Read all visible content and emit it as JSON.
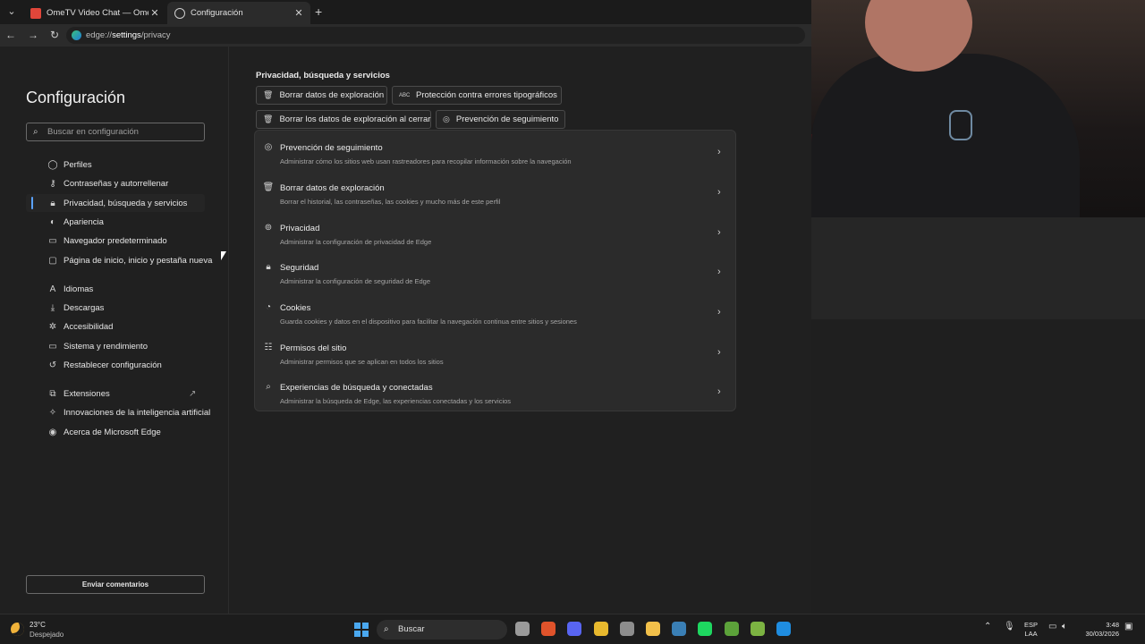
{
  "browser": {
    "tabs": [
      {
        "title": "OmeTV Video Chat — Omegle Ra",
        "active": false
      },
      {
        "title": "Configuración",
        "active": true
      }
    ],
    "address": {
      "scheme": "edge://",
      "host": "settings",
      "path": "/privacy"
    }
  },
  "sidebar": {
    "title": "Configuración",
    "search_placeholder": "Buscar en configuración",
    "items": [
      {
        "label": "Perfiles",
        "icon": "profile-icon"
      },
      {
        "label": "Contraseñas y autorrellenar",
        "icon": "key-icon"
      },
      {
        "label": "Privacidad, búsqueda y servicios",
        "icon": "lock-icon",
        "active": true
      },
      {
        "label": "Apariencia",
        "icon": "palette-icon"
      },
      {
        "label": "Navegador predeterminado",
        "icon": "browser-icon"
      },
      {
        "label": "Página de inicio, inicio y pestaña nueva",
        "icon": "home-icon"
      },
      {
        "label": "Idiomas",
        "icon": "language-icon"
      },
      {
        "label": "Descargas",
        "icon": "download-icon"
      },
      {
        "label": "Accesibilidad",
        "icon": "accessibility-icon"
      },
      {
        "label": "Sistema y rendimiento",
        "icon": "system-icon"
      },
      {
        "label": "Restablecer configuración",
        "icon": "reset-icon"
      },
      {
        "label": "Extensiones",
        "icon": "extensions-icon"
      },
      {
        "label": "Innovaciones de la inteligencia artificial",
        "icon": "ai-icon"
      },
      {
        "label": "Acerca de Microsoft Edge",
        "icon": "edge-icon"
      }
    ],
    "feedback_label": "Enviar comentarios"
  },
  "main": {
    "section_title": "Privacidad, búsqueda y servicios",
    "quick_links": [
      {
        "label": "Borrar datos de exploración",
        "icon": "trash-icon"
      },
      {
        "label": "Protección contra errores tipográficos",
        "icon": "abc-icon"
      },
      {
        "label": "Borrar los datos de exploración al cerrar",
        "icon": "trash-clock-icon"
      },
      {
        "label": "Prevención de seguimiento",
        "icon": "tracking-icon"
      }
    ],
    "rows": [
      {
        "title": "Prevención de seguimiento",
        "subtitle": "Administrar cómo los sitios web usan rastreadores para recopilar información sobre la navegación",
        "icon": "tracking-icon"
      },
      {
        "title": "Borrar datos de exploración",
        "subtitle": "Borrar el historial, las contraseñas, las cookies y mucho más de este perfil",
        "icon": "trash-icon"
      },
      {
        "title": "Privacidad",
        "subtitle": "Administrar la configuración de privacidad de Edge",
        "icon": "privacy-icon"
      },
      {
        "title": "Seguridad",
        "subtitle": "Administrar la configuración de seguridad de Edge",
        "icon": "security-icon"
      },
      {
        "title": "Cookies",
        "subtitle": "Guarda cookies y datos en el dispositivo para facilitar la navegación continua entre sitios y sesiones",
        "icon": "cookie-icon"
      },
      {
        "title": "Permisos del sitio",
        "subtitle": "Administrar permisos que se aplican en todos los sitios",
        "icon": "permissions-icon"
      },
      {
        "title": "Experiencias de búsqueda y conectadas",
        "subtitle": "Administrar la búsqueda de Edge, las experiencias conectadas y los servicios",
        "icon": "search-icon"
      }
    ]
  },
  "taskbar": {
    "weather_temp": "23°C",
    "weather_desc": "Despejado",
    "search_label": "Buscar",
    "lang_top": "ESP",
    "lang_bottom": "LAA",
    "time": "3:48",
    "date": "30/03/2026",
    "apps": [
      {
        "name": "file-explorer-icon",
        "color": "#9a9a9a"
      },
      {
        "name": "brave-icon",
        "color": "#e0532b"
      },
      {
        "name": "discord-icon",
        "color": "#5865f2"
      },
      {
        "name": "chrome-icon",
        "color": "#e8b92e"
      },
      {
        "name": "obs-icon",
        "color": "#8d8d8d"
      },
      {
        "name": "folder-icon",
        "color": "#f2c04a"
      },
      {
        "name": "steam-icon",
        "color": "#3a7fb5"
      },
      {
        "name": "spotify-icon",
        "color": "#1ed760"
      },
      {
        "name": "minecraft-icon",
        "color": "#5ca23a"
      },
      {
        "name": "minecraft-launcher-icon",
        "color": "#7cb342"
      },
      {
        "name": "edge-icon",
        "color": "#1f8de0"
      }
    ]
  }
}
